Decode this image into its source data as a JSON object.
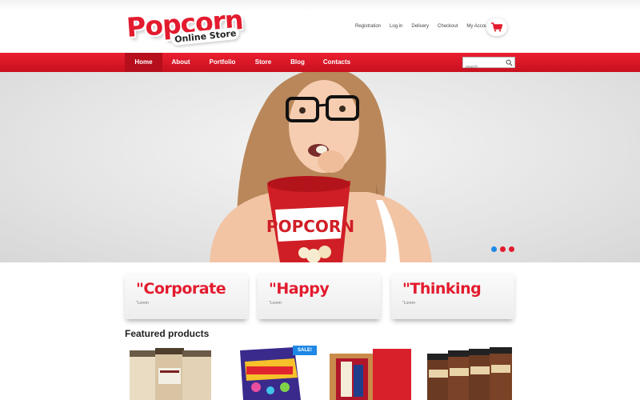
{
  "brand": {
    "logo_main": "Popcorn",
    "logo_sub": "Online Store",
    "accent_color": "#e31b2e"
  },
  "top_links": [
    {
      "label": "Registration"
    },
    {
      "label": "Log in"
    },
    {
      "label": "Delivery"
    },
    {
      "label": "Checkout"
    },
    {
      "label": "My Account"
    }
  ],
  "cart": {
    "icon": "cart-icon"
  },
  "nav": {
    "items": [
      {
        "label": "Home",
        "active": true
      },
      {
        "label": "About"
      },
      {
        "label": "Portfolio"
      },
      {
        "label": "Store"
      },
      {
        "label": "Blog"
      },
      {
        "label": "Contacts"
      }
    ]
  },
  "search": {
    "placeholder": "search",
    "icon": "search-icon"
  },
  "hero": {
    "bucket_text": "POPCORN",
    "slider_dots": [
      {
        "color": "#1e88e5",
        "active": true
      },
      {
        "color": "#e31b2e"
      },
      {
        "color": "#e31b2e"
      }
    ]
  },
  "features": [
    {
      "title": "\"Corporate",
      "subtitle": "\"Lorem"
    },
    {
      "title": "\"Happy",
      "subtitle": "\"Lorem"
    },
    {
      "title": "\"Thinking",
      "subtitle": "\"Lorem"
    }
  ],
  "featured": {
    "heading": "Featured products",
    "sale_label": "SALE!"
  }
}
